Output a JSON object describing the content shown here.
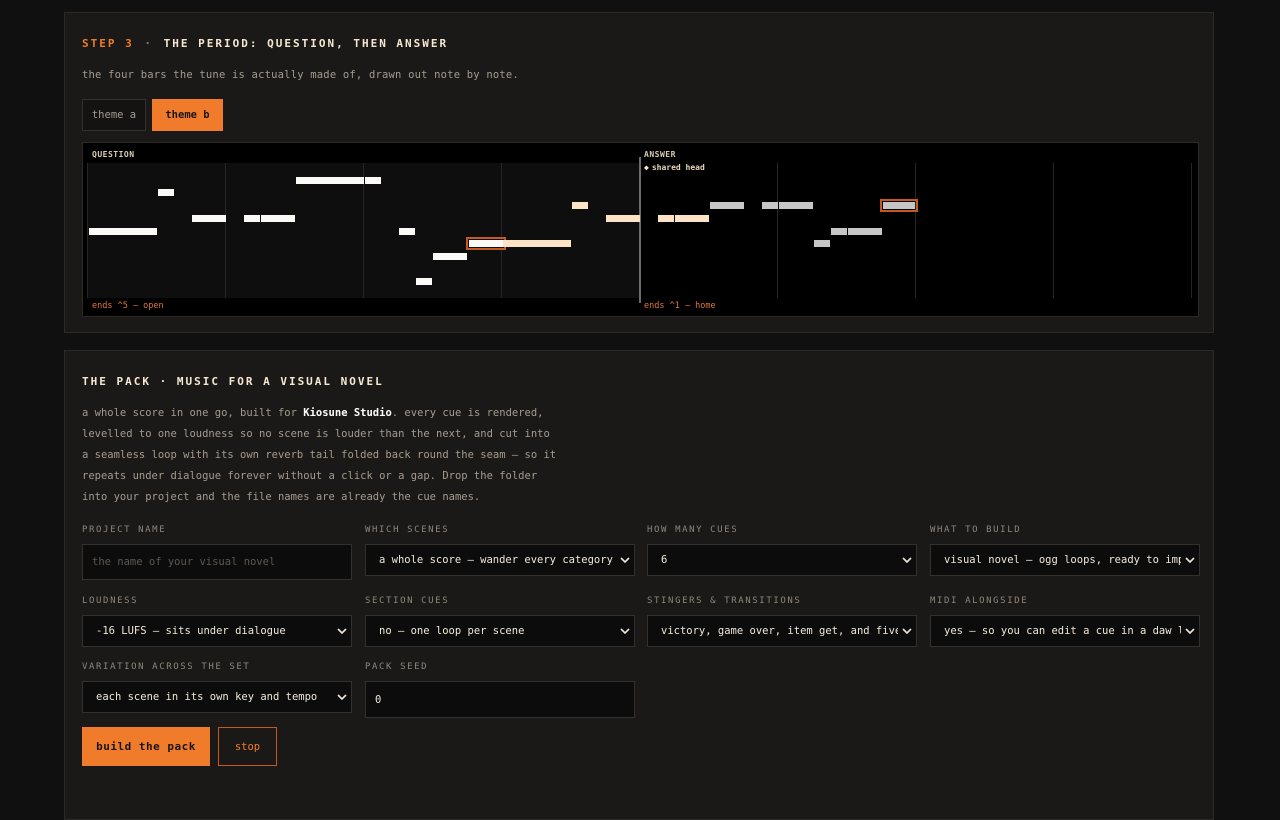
{
  "period": {
    "step": "STEP 3",
    "separator": "·",
    "title": "THE PERIOD: QUESTION, THEN ANSWER",
    "subtitle": "the four bars the tune is actually made of, drawn out note by note.",
    "tabs": [
      {
        "label": "theme a",
        "active": false
      },
      {
        "label": "theme b",
        "active": true
      }
    ],
    "roll": {
      "question_label": "QUESTION",
      "answer_label": "ANSWER",
      "shared_head_icon": "diamond-icon",
      "shared_head_label": "shared head",
      "question_footer": "ends ^5 — open",
      "answer_footer": "ends ^1 — home"
    }
  },
  "pack": {
    "title": "THE PACK · MUSIC FOR A VISUAL NOVEL",
    "desc_before": "a whole score in one go, built for ",
    "studio": "Kiosune Studio",
    "desc_after": ". every cue is rendered, levelled to one loudness so no scene is louder than the next, and cut into a seamless loop with its own reverb tail folded back round the seam — so it repeats under dialogue forever without a click or a gap. Drop the folder into your project and the file names are already the cue names.",
    "fields": {
      "project_name": {
        "label": "PROJECT NAME",
        "placeholder": "the name of your visual novel",
        "value": ""
      },
      "which_scenes": {
        "label": "WHICH SCENES",
        "value": "a whole score — wander every category"
      },
      "how_many_cues": {
        "label": "HOW MANY CUES",
        "value": "6"
      },
      "what_to_build": {
        "label": "WHAT TO BUILD",
        "value": "visual novel — ogg loops, ready to import"
      },
      "loudness": {
        "label": "LOUDNESS",
        "value": "-16 LUFS — sits under dialogue"
      },
      "section_cues": {
        "label": "SECTION CUES",
        "value": "no — one loop per scene"
      },
      "stingers": {
        "label": "STINGERS & TRANSITIONS",
        "value": "victory, game over, item get, and five transitions"
      },
      "midi": {
        "label": "MIDI ALONGSIDE",
        "value": "yes — so you can edit a cue in a daw later"
      },
      "variation": {
        "label": "VARIATION ACROSS THE SET",
        "value": "each scene in its own key and tempo"
      },
      "pack_seed": {
        "label": "PACK SEED",
        "value": "0"
      }
    },
    "build_label": "build the pack",
    "stop_label": "stop"
  },
  "colors": {
    "accent": "#f07c2b",
    "panel": "#1b1918",
    "background": "#111010"
  }
}
